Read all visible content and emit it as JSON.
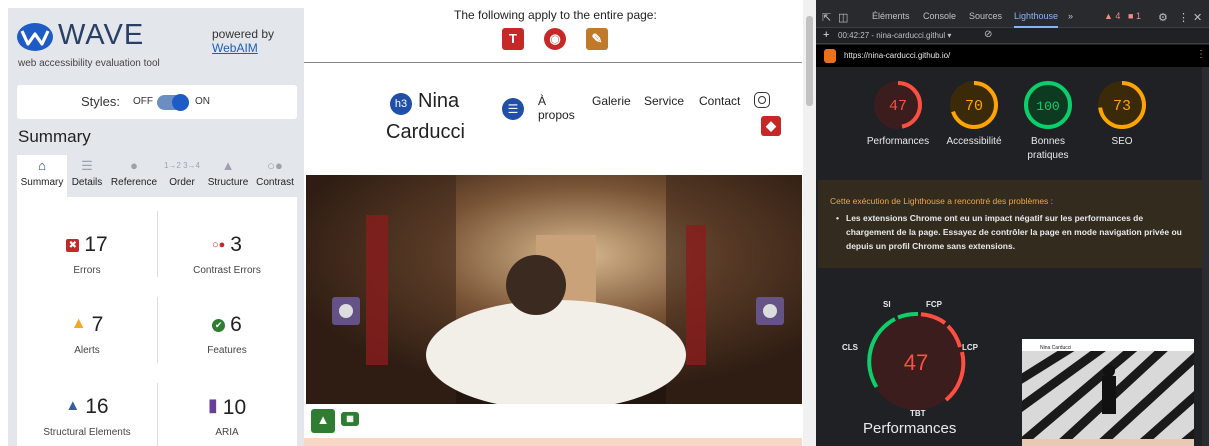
{
  "wave": {
    "brand": "WAVE",
    "tagline": "web accessibility evaluation tool",
    "powered_by": "powered by",
    "powered_link": "WebAIM",
    "styles_label": "Styles:",
    "styles_off": "OFF",
    "styles_on": "ON",
    "summary_title": "Summary",
    "tabs": [
      {
        "label": "Summary",
        "icon": "home-icon"
      },
      {
        "label": "Details",
        "icon": "list-icon"
      },
      {
        "label": "Reference",
        "icon": "info-icon"
      },
      {
        "label": "Order",
        "icon": "order-icon"
      },
      {
        "label": "Structure",
        "icon": "structure-icon"
      },
      {
        "label": "Contrast",
        "icon": "contrast-icon"
      }
    ],
    "stats": [
      {
        "count": "17",
        "label": "Errors",
        "color": "#c62828"
      },
      {
        "count": "3",
        "label": "Contrast Errors",
        "color": "#c62828"
      },
      {
        "count": "7",
        "label": "Alerts",
        "color": "#f5a623"
      },
      {
        "count": "6",
        "label": "Features",
        "color": "#2e7d32"
      },
      {
        "count": "16",
        "label": "Structural Elements",
        "color": "#3a5ba0"
      },
      {
        "count": "10",
        "label": "ARIA",
        "color": "#6a3d9a"
      }
    ]
  },
  "page": {
    "applies_text": "The following apply to the entire page:",
    "h3_badge": "h3",
    "brand_line1": "Nina",
    "brand_line2": "Carducci",
    "nav": [
      "À propos",
      "Galerie",
      "Service",
      "Contact"
    ],
    "top_icon_letter": "T"
  },
  "devtools": {
    "tabs": [
      "Éléments",
      "Console",
      "Sources",
      "Lighthouse"
    ],
    "active_tab": "Lighthouse",
    "warnings_count": "4",
    "errors_count": "1",
    "report_time": "00:42:27 - nina-carducci.githul",
    "url": "https://nina-carducci.github.io/",
    "scores": [
      {
        "value": 47,
        "label": "Performances",
        "color": "#ff4e42"
      },
      {
        "value": 70,
        "label": "Accessibilité",
        "color": "#ffa400"
      },
      {
        "value": 100,
        "label": "Bonnes pratiques",
        "color": "#0cce6b"
      },
      {
        "value": 73,
        "label": "SEO",
        "color": "#ffa400"
      }
    ],
    "warning_title": "Cette exécution de Lighthouse a rencontré des problèmes :",
    "warning_item": "Les extensions Chrome ont eu un impact négatif sur les performances de chargement de la page. Essayez de contrôler la page en mode navigation privée ou depuis un profil Chrome sans extensions.",
    "big_score": "47",
    "metrics": [
      "SI",
      "FCP",
      "LCP",
      "TBT",
      "CLS"
    ],
    "perf_label": "Performances",
    "thumb_title": "Nina Carducci"
  }
}
